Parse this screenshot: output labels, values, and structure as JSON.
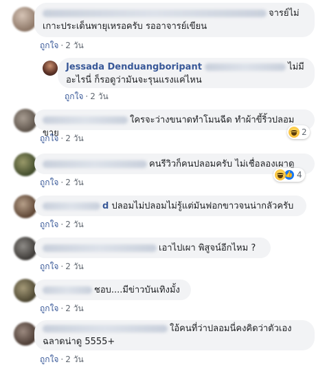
{
  "comments": [
    {
      "id": "c1",
      "text_line1": "จารย์ไม่",
      "text_line2": "เกาะประเด็นพายุเหรอครับ รออาจารย์เขียน",
      "like": "ถูกใจ",
      "time": "2 วัน"
    },
    {
      "id": "c1-reply",
      "author": "Jessada Denduangboripant",
      "text_line1": "ไม่มี",
      "text_line2": "อะไรนี่ ก็รอดูว่ามันจะรุนแรงแค่ไหน",
      "like": "ถูกใจ",
      "time": "2 วัน"
    },
    {
      "id": "c2",
      "text": "ใครจะว่างขนาดทำโมนฉีด ทำผ้าขี้ริ้วปลอมขาย",
      "like": "ถูกใจ",
      "time": "2 วัน",
      "reaction_count": "2"
    },
    {
      "id": "c3",
      "text": "คนรีวิวก็คนปลอมครับ ไม่เชื่อลองเผาดู",
      "like": "ถูกใจ",
      "time": "2 วัน",
      "reaction_count": "4"
    },
    {
      "id": "c4",
      "name_tail": "d",
      "text": "ปลอมไม่ปลอมไม่รู้แต่มันฟอกขาวจนน่ากลัวครับ",
      "like": "ถูกใจ",
      "time": "2 วัน"
    },
    {
      "id": "c5",
      "text": "เอาไปเผา พิสูจน์อีกไหม ?",
      "like": "ถูกใจ",
      "time": "2 วัน"
    },
    {
      "id": "c6",
      "text": "ชอบ....มีข่าวบันเทิงมั้ง",
      "like": "ถูกใจ",
      "time": "2 วัน"
    },
    {
      "id": "c7",
      "text_line1": "ใอ้คนที่ว่าปลอมนี่คงคิดว่าตัวเอง",
      "text_line2": "ฉลาดน่าดู 5555+",
      "like": "ถูกใจ",
      "time": "2 วัน"
    }
  ],
  "separator": "·",
  "colors": {
    "link": "#385898",
    "bubble": "#f2f3f5",
    "meta": "#606770"
  }
}
